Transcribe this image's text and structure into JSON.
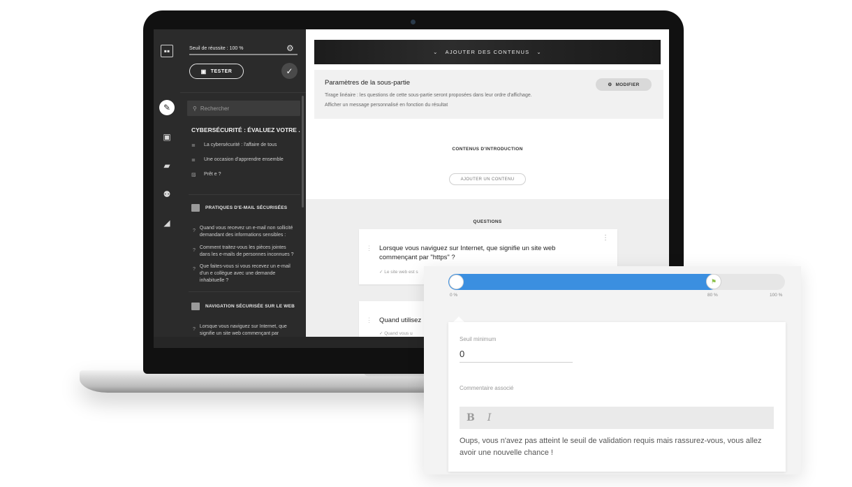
{
  "sidebar": {
    "threshold_label": "Seuil de réussite : 100 %",
    "tester_label": "TESTER",
    "search_placeholder": "Rechercher",
    "course_title": "CYBERSÉCURITÉ : ÉVALUEZ VOTRE ...",
    "items": [
      {
        "label": "La cybersécurité : l'affaire de tous"
      },
      {
        "label": "Une occasion d'apprendre ensemble"
      },
      {
        "label": "Prêt e ?"
      }
    ],
    "sections": [
      {
        "label": "PRATIQUES D'E-MAIL SÉCURISÉES",
        "questions": [
          "Quand vous recevez un e-mail non sollicité demandant des informations sensibles :",
          "Comment traitez-vous les pièces jointes dans les e-mails de personnes inconnues ?",
          "Que faites-vous si vous recevez un e-mail d'un e collègue avec une demande inhabituelle ?"
        ]
      },
      {
        "label": "NAVIGATION SÉCURISÉE SUR LE WEB",
        "questions": [
          "Lorsque vous naviguez sur Internet, que signifie un site web commençant par"
        ]
      }
    ]
  },
  "main": {
    "add_bar_label": "AJOUTER DES CONTENUS",
    "params": {
      "title": "Paramètres de la sous-partie",
      "line1": "Tirage linéaire : les questions de cette sous-partie seront proposées dans leur ordre d'affichage.",
      "line2": "Afficher un message personnalisé en fonction du résultat",
      "modify_label": "MODIFIER"
    },
    "intro_label": "CONTENUS D'INTRODUCTION",
    "add_content_label": "AJOUTER UN CONTENU",
    "questions_label": "QUESTIONS",
    "questions": [
      {
        "text": "Lorsque vous naviguez sur Internet, que signifie un site web commençant par \"https\" ?",
        "answer": "✓ Le site web est s"
      },
      {
        "text": "Quand utilisez",
        "answer": "✓ Quand vous u"
      }
    ]
  },
  "overlay": {
    "slider": {
      "value_percent": 0,
      "threshold_percent": 80,
      "min_label": "0 %",
      "threshold_label": "80 %",
      "max_label": "100 %",
      "fill_color": "#3b8fe0",
      "flag_color": "#8cc04a"
    },
    "min_label": "Seuil minimum",
    "min_value": "0",
    "comment_label": "Commentaire associé",
    "bold_label": "B",
    "italic_label": "I",
    "comment_text": "Oups, vous n'avez pas atteint le seuil de validation requis mais rassurez-vous, vous allez avoir une nouvelle chance !"
  }
}
